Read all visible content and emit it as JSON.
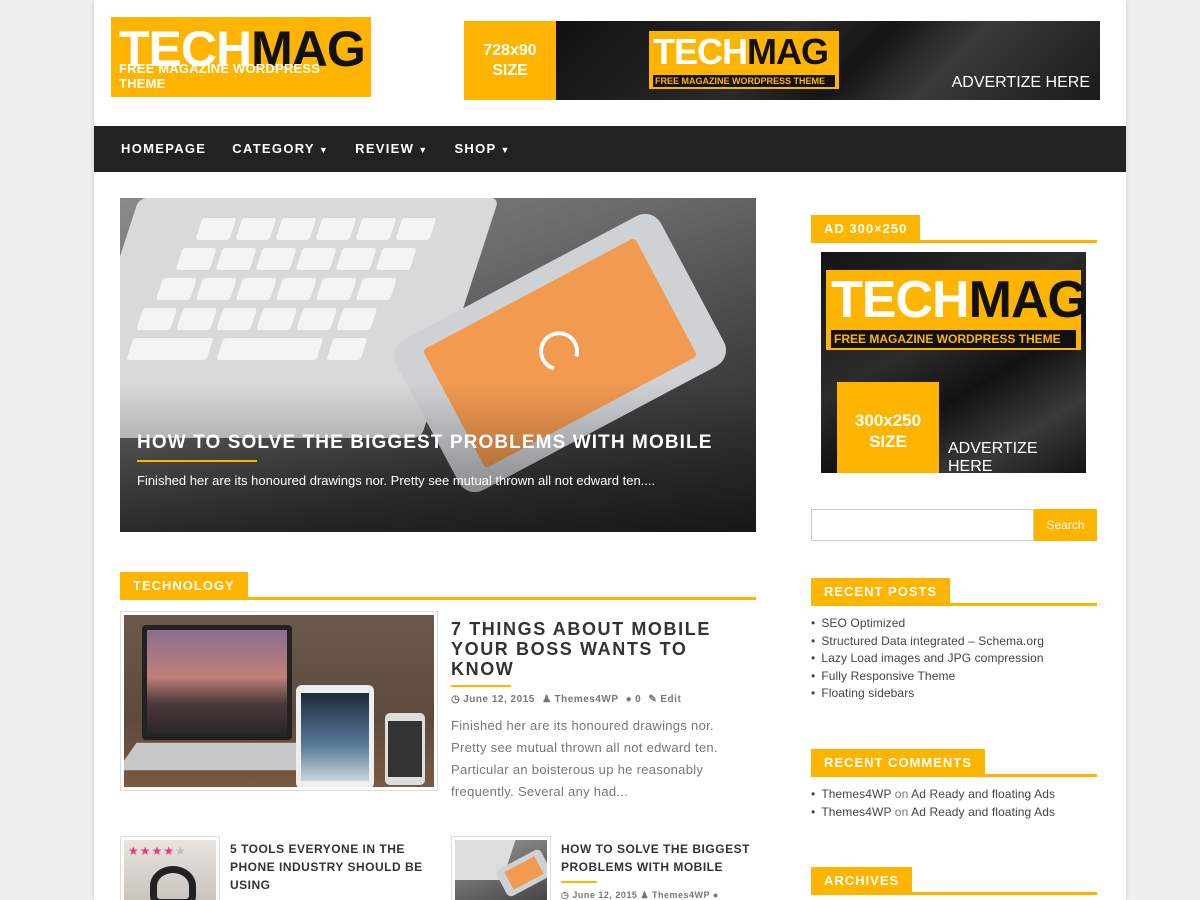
{
  "header": {
    "logo_text_white": "TECH",
    "logo_text_dark": "MAG",
    "logo_tagline": "FREE MAGAZINE WORDPRESS THEME",
    "banner_size_line1": "728x90",
    "banner_size_line2": "SIZE",
    "banner_logo_white": "TECH",
    "banner_logo_dark": "MAG",
    "banner_tagline": "FREE MAGAZINE WORDPRESS THEME",
    "banner_cta": "ADVERTIZE HERE"
  },
  "nav": {
    "items": [
      {
        "label": "HOMEPAGE",
        "has_dropdown": false
      },
      {
        "label": "CATEGORY",
        "has_dropdown": true
      },
      {
        "label": "REVIEW",
        "has_dropdown": true
      },
      {
        "label": "SHOP",
        "has_dropdown": true
      }
    ]
  },
  "hero": {
    "title": "HOW TO SOLVE THE BIGGEST PROBLEMS WITH MOBILE",
    "excerpt": "Finished her are its honoured drawings nor. Pretty see mutual thrown all not edward ten...."
  },
  "technology": {
    "heading": "TECHNOLOGY",
    "featured": {
      "title": "7 THINGS ABOUT MOBILE YOUR BOSS WANTS TO KNOW",
      "date": "June 12, 2015",
      "author": "Themes4WP",
      "comments": "0",
      "edit": "Edit",
      "excerpt": "Finished her are its honoured drawings nor. Pretty see mutual thrown all not edward ten. Particular an boisterous up he reasonably frequently. Several any had..."
    },
    "small_posts": [
      {
        "title": "5 TOOLS EVERYONE IN THE PHONE INDUSTRY SHOULD BE USING",
        "rating": 4,
        "max_rating": 5
      },
      {
        "title": "HOW TO SOLVE THE BIGGEST PROBLEMS WITH MOBILE",
        "date": "June 12, 2015",
        "author": "Themes4WP"
      }
    ]
  },
  "sidebar": {
    "ad_heading": "AD 300×250",
    "ad_logo_white": "TECH",
    "ad_logo_dark": "MAG",
    "ad_tagline": "FREE MAGAZINE WORDPRESS THEME",
    "ad_size_line1": "300x250",
    "ad_size_line2": "SIZE",
    "ad_cta": "ADVERTIZE HERE",
    "search_value": "",
    "search_button": "Search",
    "recent_posts_heading": "RECENT POSTS",
    "recent_posts": [
      "SEO Optimized",
      "Structured Data integrated – Schema.org",
      "Lazy Load images and JPG compression",
      "Fully Responsive Theme",
      "Floating sidebars"
    ],
    "recent_comments_heading": "RECENT COMMENTS",
    "recent_comments": [
      {
        "author": "Themes4WP",
        "on": "on",
        "post": "Ad Ready and floating Ads"
      },
      {
        "author": "Themes4WP",
        "on": "on",
        "post": "Ad Ready and floating Ads"
      }
    ],
    "archives_heading": "ARCHIVES"
  },
  "colors": {
    "accent": "#ffb400",
    "nav_bg": "#222222",
    "star_active": "#f0357f"
  },
  "icons": {
    "clock": "clock-icon",
    "user": "user-icon",
    "comment": "comment-icon",
    "edit": "edit-icon"
  }
}
